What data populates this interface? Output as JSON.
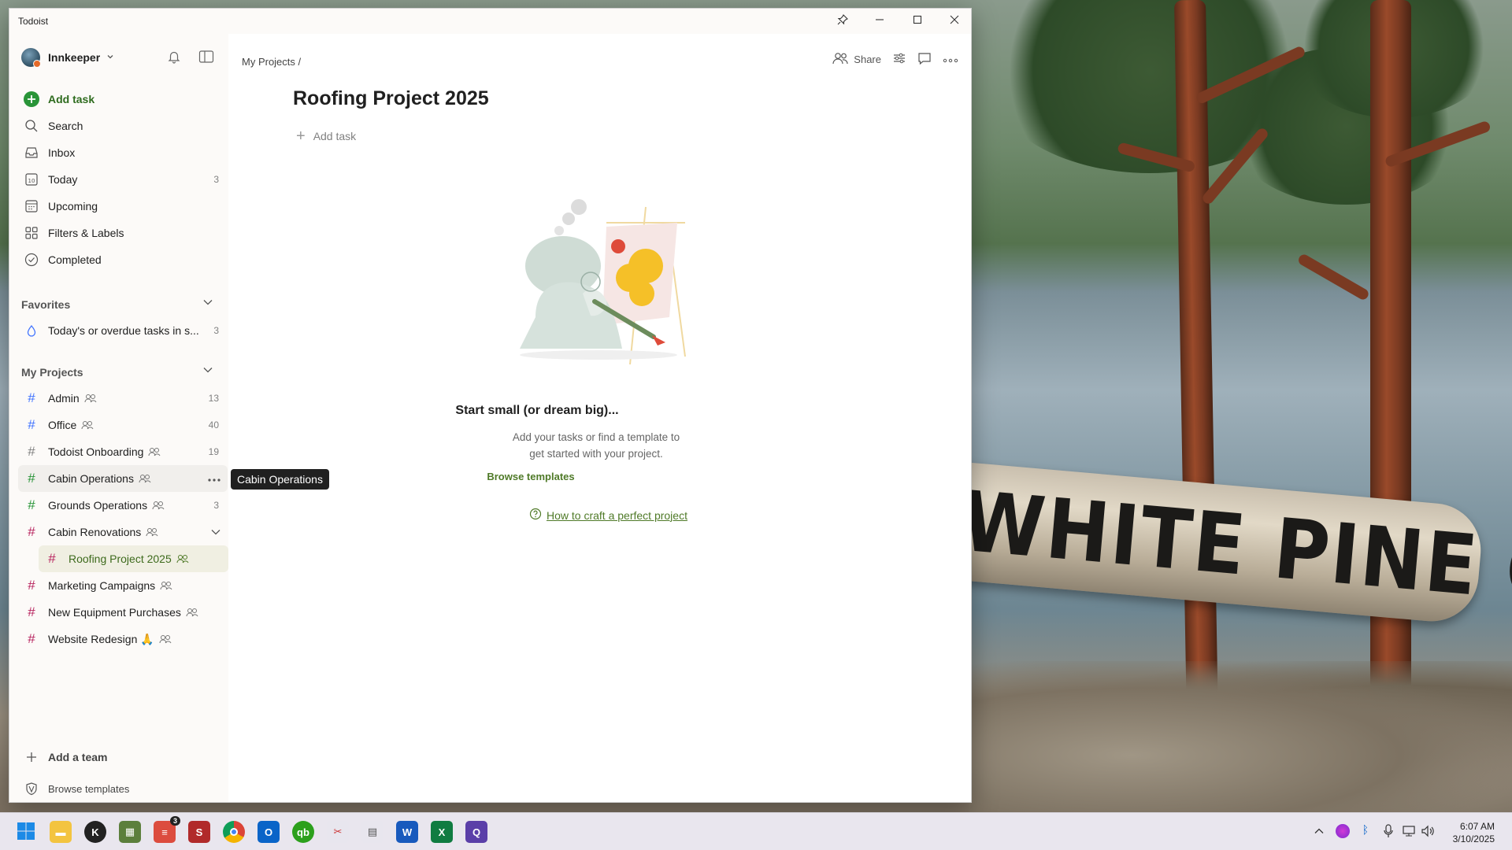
{
  "window": {
    "title": "Todoist"
  },
  "sidebar": {
    "user": "Innkeeper",
    "add_task": "Add task",
    "nav": [
      {
        "label": "Search",
        "count": ""
      },
      {
        "label": "Inbox",
        "count": ""
      },
      {
        "label": "Today",
        "count": "3"
      },
      {
        "label": "Upcoming",
        "count": ""
      },
      {
        "label": "Filters & Labels",
        "count": ""
      },
      {
        "label": "Completed",
        "count": ""
      }
    ],
    "favorites_title": "Favorites",
    "favorites": [
      {
        "label": "Today's or overdue tasks in s...",
        "count": "3"
      }
    ],
    "projects_title": "My Projects",
    "projects": [
      {
        "label": "Admin",
        "count": "13",
        "color": "#4073ff"
      },
      {
        "label": "Office",
        "count": "40",
        "color": "#4073ff"
      },
      {
        "label": "Todoist Onboarding",
        "count": "19",
        "color": "#808080"
      },
      {
        "label": "Cabin Operations",
        "count": "",
        "color": "#299438"
      },
      {
        "label": "Grounds Operations",
        "count": "3",
        "color": "#299438"
      },
      {
        "label": "Cabin Renovations",
        "count": "",
        "color": "#b8255f"
      },
      {
        "label": "Roofing Project 2025",
        "count": "",
        "color": "#b8255f"
      },
      {
        "label": "Marketing Campaigns",
        "count": "",
        "color": "#b8255f"
      },
      {
        "label": "New Equipment Purchases",
        "count": "",
        "color": "#b8255f"
      },
      {
        "label": "Website Redesign 🙏",
        "count": "",
        "color": "#b8255f"
      }
    ],
    "add_team": "Add a team",
    "browse_templates": "Browse templates"
  },
  "tooltip": "Cabin Operations",
  "main": {
    "breadcrumb": "My Projects /",
    "share_label": "Share",
    "title": "Roofing Project 2025",
    "add_task": "Add task",
    "empty_title": "Start small (or dream big)...",
    "empty_desc": "Add your tasks or find a template to get started with your project.",
    "browse_templates": "Browse templates",
    "craft_link": "How to craft a perfect project"
  },
  "wallpaper": {
    "sign_text": "WHITE PINE CAMP"
  },
  "taskbar": {
    "todoist_badge": "3",
    "time": "6:07 AM",
    "date": "3/10/2025"
  },
  "colors": {
    "accent_green": "#4f7a28",
    "add_task_red": "#299438"
  }
}
